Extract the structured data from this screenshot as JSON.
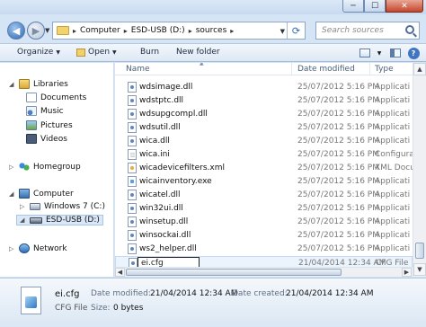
{
  "window": {
    "min_glyph": "─",
    "max_glyph": "☐",
    "close_glyph": "✕"
  },
  "address": {
    "crumbs": [
      "Computer",
      "ESD-USB (D:)",
      "sources"
    ],
    "separator": "▸",
    "search_placeholder": "Search sources"
  },
  "toolbar": {
    "organize_label": "Organize",
    "open_label": "Open",
    "burn_label": "Burn",
    "new_folder_label": "New folder",
    "dropdown_glyph": "▼",
    "help_glyph": "?"
  },
  "navpane": {
    "libraries": "Libraries",
    "documents": "Documents",
    "music": "Music",
    "pictures": "Pictures",
    "videos": "Videos",
    "homegroup": "Homegroup",
    "computer": "Computer",
    "windows7": "Windows 7 (C:)",
    "esdusb": "ESD-USB (D:)",
    "network": "Network"
  },
  "columns": {
    "name": "Name",
    "date_modified": "Date modified",
    "type": "Type"
  },
  "files": [
    {
      "name": "wdsimage.dll",
      "date": "25/07/2012 5:16 PM",
      "type": "Applicati",
      "icon": "dll-icon"
    },
    {
      "name": "wdstptc.dll",
      "date": "25/07/2012 5:16 PM",
      "type": "Applicati",
      "icon": "dll-icon"
    },
    {
      "name": "wdsupgcompl.dll",
      "date": "25/07/2012 5:16 PM",
      "type": "Applicati",
      "icon": "dll-icon"
    },
    {
      "name": "wdsutil.dll",
      "date": "25/07/2012 5:16 PM",
      "type": "Applicati",
      "icon": "dll-icon"
    },
    {
      "name": "wica.dll",
      "date": "25/07/2012 5:16 PM",
      "type": "Applicati",
      "icon": "dll-icon"
    },
    {
      "name": "wica.ini",
      "date": "25/07/2012 5:16 PM",
      "type": "Configura",
      "icon": "ini-icon"
    },
    {
      "name": "wicadevicefilters.xml",
      "date": "25/07/2012 5:16 PM",
      "type": "XML Docu",
      "icon": "xml-icon"
    },
    {
      "name": "wicainventory.exe",
      "date": "25/07/2012 5:16 PM",
      "type": "Applicati",
      "icon": "exe-icon"
    },
    {
      "name": "wicatel.dll",
      "date": "25/07/2012 5:16 PM",
      "type": "Applicati",
      "icon": "dll-icon"
    },
    {
      "name": "win32ui.dll",
      "date": "25/07/2012 5:16 PM",
      "type": "Applicati",
      "icon": "dll-icon"
    },
    {
      "name": "winsetup.dll",
      "date": "25/07/2012 5:16 PM",
      "type": "Applicati",
      "icon": "dll-icon"
    },
    {
      "name": "winsockai.dll",
      "date": "25/07/2012 5:16 PM",
      "type": "Applicati",
      "icon": "dll-icon"
    },
    {
      "name": "ws2_helper.dll",
      "date": "25/07/2012 5:16 PM",
      "type": "Applicati",
      "icon": "dll-icon"
    }
  ],
  "renaming_file": {
    "name": "ei.cfg",
    "date": "21/04/2014 12:34 AM",
    "type": "CFG File"
  },
  "details": {
    "name": "ei.cfg",
    "type": "CFG File",
    "date_modified_label": "Date modified:",
    "date_modified_value": "21/04/2014 12:34 AM",
    "date_created_label": "Date created:",
    "date_created_value": "21/04/2014 12:34 AM",
    "size_label": "Size:",
    "size_value": "0 bytes"
  }
}
